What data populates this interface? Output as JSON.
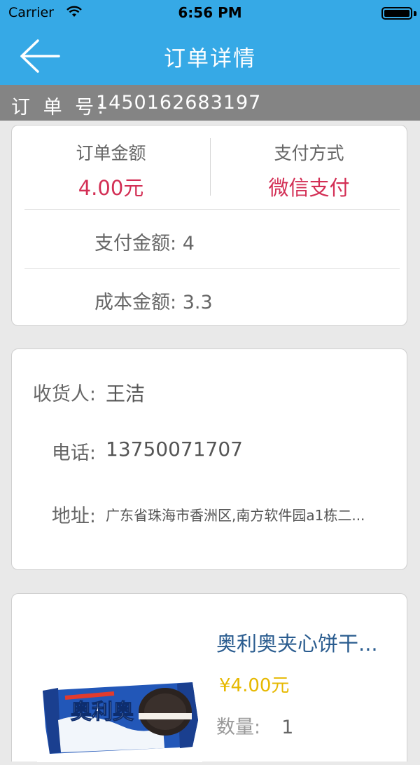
{
  "status": {
    "carrier": "Carrier",
    "time": "6:56 PM"
  },
  "header": {
    "title": "订单详情",
    "back_icon": "arrow-left-icon"
  },
  "order": {
    "label": "订 单 号:",
    "number": "1450162683197"
  },
  "summary": {
    "amount_label": "订单金额",
    "amount_value": "4.00元",
    "method_label": "支付方式",
    "method_value": "微信支付",
    "paid_label": "支付金额:",
    "paid_value": "4",
    "cost_label": "成本金额:",
    "cost_value": "3.3",
    "accent_color": "#d32f55"
  },
  "recipient": {
    "name_label": "收货人:",
    "name_value": "王洁",
    "phone_label": "电话:",
    "phone_value": "13750071707",
    "address_label": "地址:",
    "address_value": "广东省珠海市香洲区,南方软件园a1栋二..."
  },
  "product": {
    "name": "奥利奥夹心饼干...",
    "price": "¥4.00元",
    "qty_label": "数量:",
    "qty_value": "1",
    "image_icon": "oreo-package-image",
    "package_text": "奥利奥"
  },
  "colors": {
    "brand": "#36a9e6",
    "order_bar": "#848484",
    "price": "#e6b800",
    "product_name": "#2a5c8f"
  }
}
